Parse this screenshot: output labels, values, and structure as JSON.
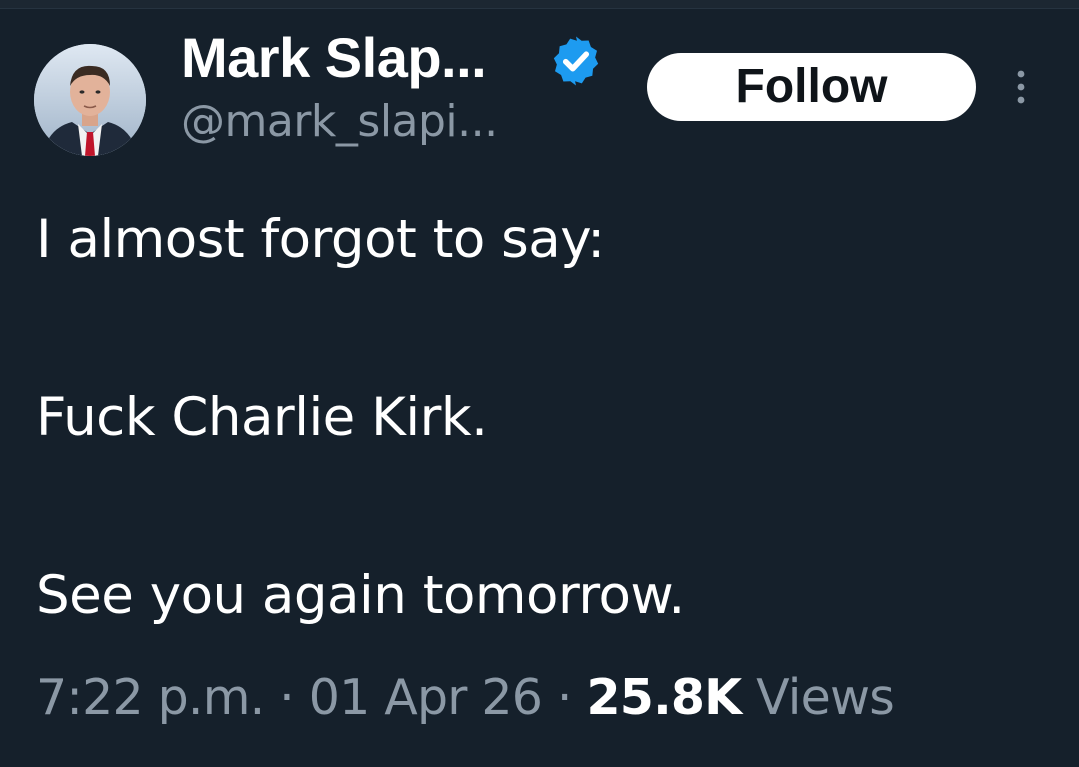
{
  "author": {
    "display_name": "Mark Slap...",
    "handle": "@mark_slapi...",
    "verified": true,
    "verified_color": "#1d9bf0"
  },
  "actions": {
    "follow_label": "Follow",
    "more_icon": "more-vertical-icon"
  },
  "tweet": {
    "lines": [
      "I almost forgot to say:",
      "Fuck Charlie Kirk.",
      "See you again tomorrow."
    ]
  },
  "meta": {
    "time": "7:22 p.m.",
    "separator": " · ",
    "date": "01 Apr 26",
    "views_count": "25.8K",
    "views_label": "Views"
  },
  "colors": {
    "background": "#15202b",
    "primary_text": "#ffffff",
    "secondary_text": "#8b98a5",
    "accent": "#1d9bf0"
  }
}
